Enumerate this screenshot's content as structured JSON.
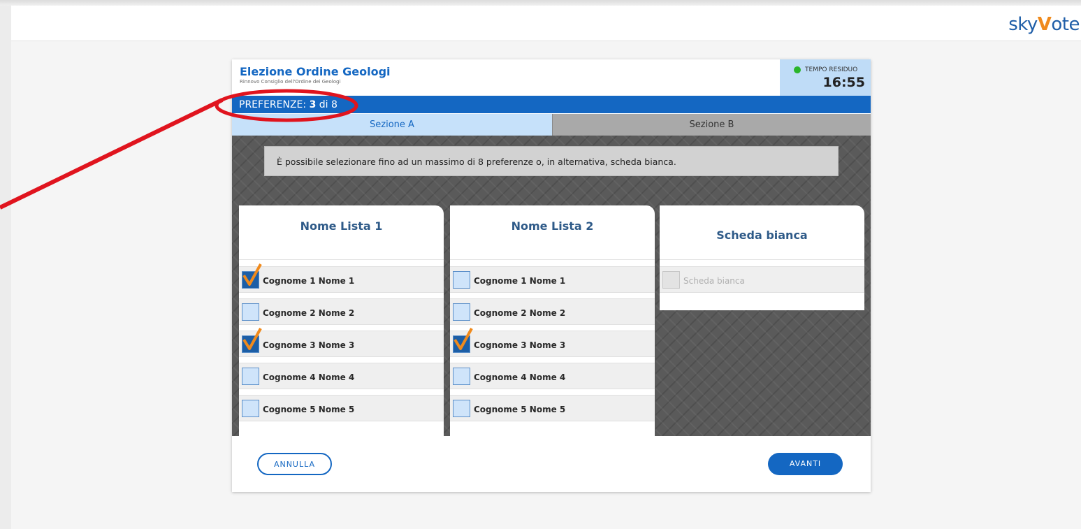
{
  "brand": {
    "logo_sky": "sky",
    "logo_v": "V",
    "logo_ote": "ote"
  },
  "election": {
    "title": "Elezione Ordine Geologi",
    "subtitle": "Rinnovo Consiglio dell'Ordine dei Geologi"
  },
  "timer": {
    "label": "TEMPO RESIDUO",
    "value": "16:55",
    "status_color": "#2ab52a"
  },
  "preferences": {
    "label": "PREFERENZE: ",
    "selected": "3",
    "of_text": " di 8"
  },
  "tabs": [
    {
      "label": "Sezione A",
      "active": true
    },
    {
      "label": "Sezione B",
      "active": false
    }
  ],
  "notice": "È possibile selezionare fino ad un massimo di 8 preferenze o, in alternativa, scheda bianca.",
  "lists": [
    {
      "name": "Nome Lista 1",
      "candidates": [
        {
          "label": "Cognome 1 Nome 1",
          "checked": true
        },
        {
          "label": "Cognome 2 Nome 2",
          "checked": false
        },
        {
          "label": "Cognome 3 Nome 3",
          "checked": true
        },
        {
          "label": "Cognome 4 Nome 4",
          "checked": false
        },
        {
          "label": "Cognome 5 Nome 5",
          "checked": false
        }
      ]
    },
    {
      "name": "Nome Lista 2",
      "candidates": [
        {
          "label": "Cognome 1 Nome 1",
          "checked": false
        },
        {
          "label": "Cognome 2 Nome 2",
          "checked": false
        },
        {
          "label": "Cognome 3 Nome 3",
          "checked": true
        },
        {
          "label": "Cognome 4 Nome 4",
          "checked": false
        },
        {
          "label": "Cognome 5 Nome 5",
          "checked": false
        }
      ]
    },
    {
      "name": "Scheda bianca",
      "candidates": [
        {
          "label": "Scheda bianca",
          "checked": false,
          "disabled": true
        }
      ]
    }
  ],
  "buttons": {
    "cancel": "ANNULLA",
    "next": "AVANTI"
  },
  "colors": {
    "primary": "#1467c2",
    "check_mark": "#f08a1c",
    "annotation": "#e0141e"
  }
}
